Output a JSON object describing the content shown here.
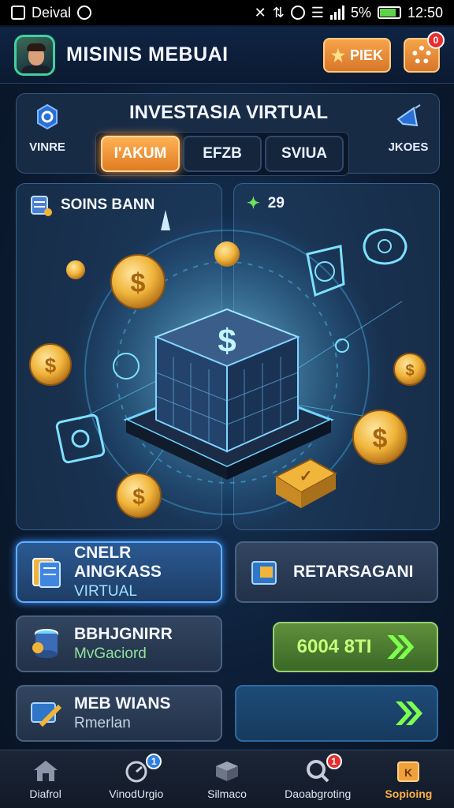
{
  "status_bar": {
    "carrier": "Deival",
    "battery_percent": "5%",
    "time": "12:50"
  },
  "header": {
    "title": "MISINIS MEBUAI",
    "piek_label": "PIEK",
    "settings_badge": "0"
  },
  "invest": {
    "title": "INVESTASIA VIRTUAL",
    "left_label": "VINRE",
    "right_label": "JKOES",
    "tabs": [
      {
        "label": "I'AKUM",
        "active": true
      },
      {
        "label": "EFZB",
        "active": false
      },
      {
        "label": "SVIUA",
        "active": false
      }
    ]
  },
  "hero": {
    "left_title": "SOINS BANN",
    "right_value": "29"
  },
  "actions": {
    "card1_main": "CNELR AINGKASS",
    "card1_sub": "VIRTUAL",
    "card2_main": "RETARSAGANI",
    "card3_main": "BBHJGNIRR",
    "card3_sub": "MvGaciord",
    "go_value": "6004 8TI",
    "card4_main": "MEB WIANS",
    "card4_sub": "Rmerlan"
  },
  "nav": {
    "items": [
      {
        "label": "Diafrol",
        "icon": "home-icon"
      },
      {
        "label": "VinodUrgio",
        "icon": "dashboard-icon",
        "badge": "1"
      },
      {
        "label": "Silmaco",
        "icon": "box-icon"
      },
      {
        "label": "Daoabgroting",
        "icon": "search-icon",
        "badge": "1"
      },
      {
        "label": "Sopioing",
        "icon": "shop-icon",
        "active": true
      }
    ]
  }
}
